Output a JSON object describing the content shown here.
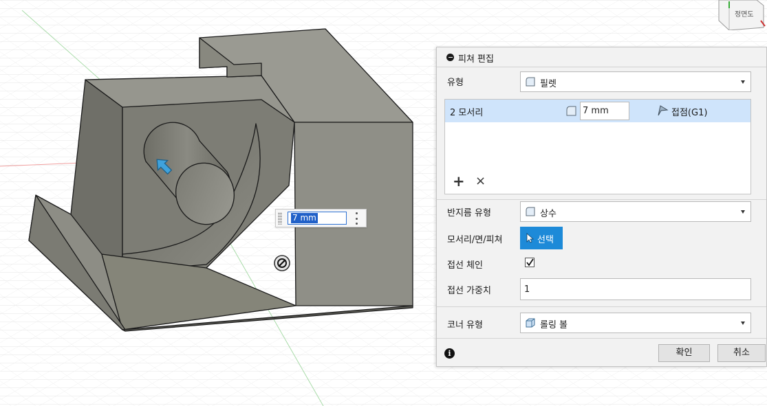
{
  "viewport": {
    "dimension_input": "7 mm",
    "viewcube_face": "정면도"
  },
  "panel": {
    "title": "피쳐 편집",
    "type_label": "유형",
    "type_value": "필렛",
    "edge_row": {
      "label": "2 모서리",
      "radius": "7 mm",
      "continuity": "접점(G1)"
    },
    "add_symbol": "+",
    "remove_symbol": "×",
    "radius_type_label": "반지름 유형",
    "radius_type_value": "상수",
    "edges_label": "모서리/면/피쳐",
    "select_button": "선택",
    "tangent_chain_label": "접선 체인",
    "tangent_chain_checked": true,
    "tangent_weight_label": "접선 가중치",
    "tangent_weight_value": "1",
    "corner_type_label": "코너 유형",
    "corner_type_value": "롤링 볼",
    "info_symbol": "i",
    "ok_button": "확인",
    "cancel_button": "취소"
  },
  "colors": {
    "selection_blue": "#1d8ad8",
    "row_highlight": "#cfe4fb",
    "model_gray": "#8a8a80"
  },
  "icons": [
    "fillet-icon",
    "tangent-flag-icon",
    "cursor-icon",
    "corner-icon",
    "info-icon",
    "collapse-icon",
    "move-arrow-icon",
    "direction-handle-icon"
  ]
}
